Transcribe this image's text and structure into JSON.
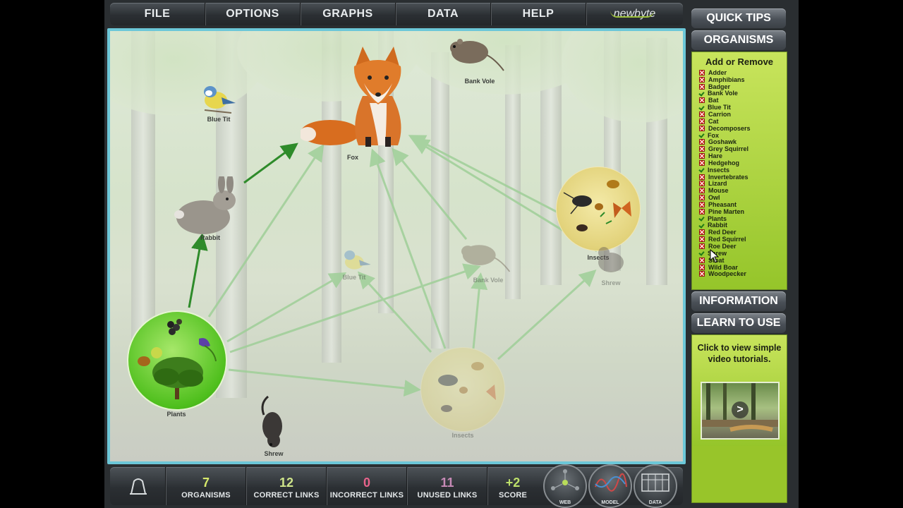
{
  "menu": {
    "items": [
      "FILE",
      "OPTIONS",
      "GRAPHS",
      "DATA",
      "HELP"
    ],
    "brand": "newbyte"
  },
  "scene": {
    "labels": {
      "fox": "Fox",
      "bank_vole": "Bank Vole",
      "blue_tit": "Blue Tit",
      "rabbit": "Rabbit",
      "insects": "Insects",
      "plants": "Plants",
      "shrew": "Shrew",
      "shrew_faded": "Shrew",
      "bank_vole_faded": "Bank Vole",
      "blue_tit_faded": "Blue Tit",
      "insects_faded": "Insects"
    }
  },
  "stats": {
    "organisms": {
      "value": "7",
      "label": "ORGANISMS"
    },
    "correct_links": {
      "value": "12",
      "label": "CORRECT LINKS"
    },
    "incorrect_links": {
      "value": "0",
      "label": "INCORRECT LINKS"
    },
    "unused_links": {
      "value": "11",
      "label": "UNUSED LINKS"
    },
    "score": {
      "value": "+2",
      "label": "SCORE"
    }
  },
  "bottom_buttons": {
    "web": "WEB",
    "model": "MODEL",
    "data": "DATA"
  },
  "right_panel": {
    "quick_tips": "QUICK TIPS",
    "organisms": "ORGANISMS",
    "add_remove": "Add or Remove",
    "organism_list": [
      {
        "name": "Adder",
        "checked": false
      },
      {
        "name": "Amphibians",
        "checked": false
      },
      {
        "name": "Badger",
        "checked": false
      },
      {
        "name": "Bank Vole",
        "checked": true
      },
      {
        "name": "Bat",
        "checked": false
      },
      {
        "name": "Blue Tit",
        "checked": true
      },
      {
        "name": "Carrion",
        "checked": false
      },
      {
        "name": "Cat",
        "checked": false
      },
      {
        "name": "Decomposers",
        "checked": false
      },
      {
        "name": "Fox",
        "checked": true
      },
      {
        "name": "Goshawk",
        "checked": false
      },
      {
        "name": "Grey Squirrel",
        "checked": false
      },
      {
        "name": "Hare",
        "checked": false
      },
      {
        "name": "Hedgehog",
        "checked": false
      },
      {
        "name": "Insects",
        "checked": true
      },
      {
        "name": "Invertebrates",
        "checked": false
      },
      {
        "name": "Lizard",
        "checked": false
      },
      {
        "name": "Mouse",
        "checked": false
      },
      {
        "name": "Owl",
        "checked": false
      },
      {
        "name": "Pheasant",
        "checked": false
      },
      {
        "name": "Pine Marten",
        "checked": false
      },
      {
        "name": "Plants",
        "checked": true
      },
      {
        "name": "Rabbit",
        "checked": true
      },
      {
        "name": "Red Deer",
        "checked": false
      },
      {
        "name": "Red Squirrel",
        "checked": false
      },
      {
        "name": "Roe Deer",
        "checked": false
      },
      {
        "name": "Shrew",
        "checked": true
      },
      {
        "name": "Stoat",
        "checked": false
      },
      {
        "name": "Wild Boar",
        "checked": false
      },
      {
        "name": "Woodpecker",
        "checked": false
      }
    ],
    "information": "INFORMATION",
    "learn_to_use": "LEARN TO USE",
    "learn_text": "Click to view simple video tutorials.",
    "play_symbol": ">"
  },
  "colors": {
    "accent_green": "#2e8b2a",
    "faded_link": "#9fcf98",
    "panel_green": "#a9d23a",
    "border_teal": "#6cc7d8"
  }
}
